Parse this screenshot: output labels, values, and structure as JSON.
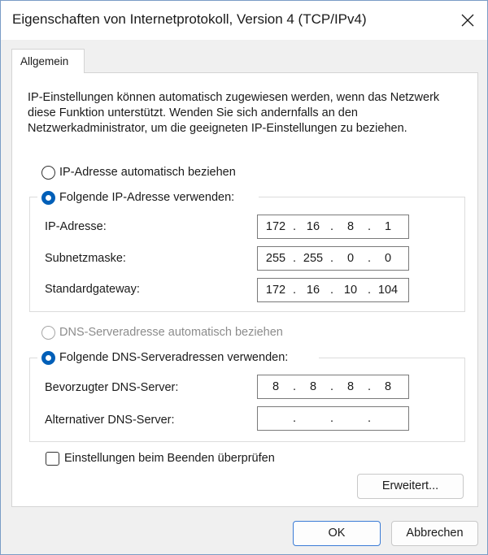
{
  "window": {
    "title": "Eigenschaften von Internetprotokoll, Version 4 (TCP/IPv4)"
  },
  "tabs": [
    {
      "label": "Allgemein",
      "selected": true
    }
  ],
  "description": "IP-Einstellungen können automatisch zugewiesen werden, wenn das Netzwerk diese Funktion unterstützt. Wenden Sie sich andernfalls an den Netzwerkadministrator, um die geeigneten IP-Einstellungen zu beziehen.",
  "ip": {
    "auto_label": "IP-Adresse automatisch beziehen",
    "manual_label": "Folgende IP-Adresse verwenden:",
    "selected": "manual",
    "fields": [
      {
        "label": "IP-Adresse:",
        "octets": [
          "172",
          "16",
          "8",
          "1"
        ]
      },
      {
        "label": "Subnetzmaske:",
        "octets": [
          "255",
          "255",
          "0",
          "0"
        ]
      },
      {
        "label": "Standardgateway:",
        "octets": [
          "172",
          "16",
          "10",
          "104"
        ]
      }
    ]
  },
  "dns": {
    "auto_label": "DNS-Serveradresse automatisch beziehen",
    "auto_disabled": true,
    "manual_label": "Folgende DNS-Serveradressen verwenden:",
    "selected": "manual",
    "fields": [
      {
        "label": "Bevorzugter DNS-Server:",
        "octets": [
          "8",
          "8",
          "8",
          "8"
        ]
      },
      {
        "label": "Alternativer DNS-Server:",
        "octets": [
          "",
          "",
          "",
          ""
        ]
      }
    ]
  },
  "validate": {
    "label": "Einstellungen beim Beenden überprüfen",
    "checked": false
  },
  "buttons": {
    "advanced": "Erweitert...",
    "ok": "OK",
    "cancel": "Abbrechen"
  },
  "separator": ".",
  "colors": {
    "accent": "#005fb8",
    "border": "#7a7a7a",
    "panel_bg": "#ffffff",
    "window_bg": "#f0f0f0"
  },
  "icons": {
    "close": "close-icon"
  }
}
